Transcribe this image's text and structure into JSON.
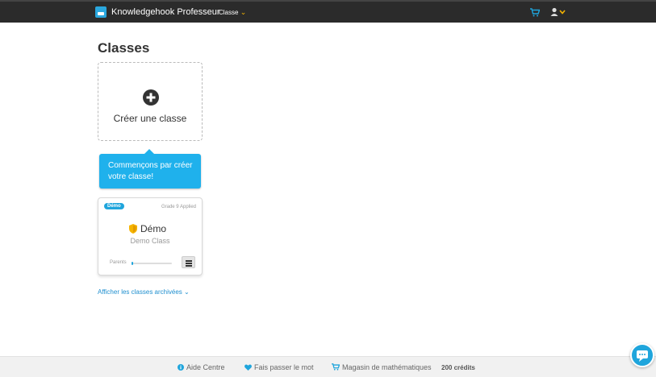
{
  "header": {
    "brand": "Knowledgehook Professeur",
    "class_menu": "Classe"
  },
  "main": {
    "title": "Classes",
    "create_card": {
      "label": "Créer une classe"
    },
    "tooltip": "Commençons par créer votre classe!",
    "class_card": {
      "badge": "Démo",
      "grade": "Grade 9 Applied",
      "name": "Démo",
      "subtitle": "Demo Class",
      "parents_label": "Parents",
      "parents_progress": 0.04
    },
    "archive_link": "Afficher les classes archivées"
  },
  "footer": {
    "help": "Aide Centre",
    "share": "Fais passer le mot",
    "store": "Magasin de mathématiques",
    "credits": "200 crédits"
  },
  "colors": {
    "accent": "#1fa5dc",
    "topbar": "#2b2b2b",
    "chevron": "#f5b400",
    "badge_shield": "#f5b400"
  },
  "icons": [
    "logo-icon",
    "cart-icon",
    "user-icon",
    "plus-circle-icon",
    "shield-icon",
    "hamburger-icon",
    "info-icon",
    "heart-icon",
    "cart-icon",
    "chat-icon"
  ]
}
